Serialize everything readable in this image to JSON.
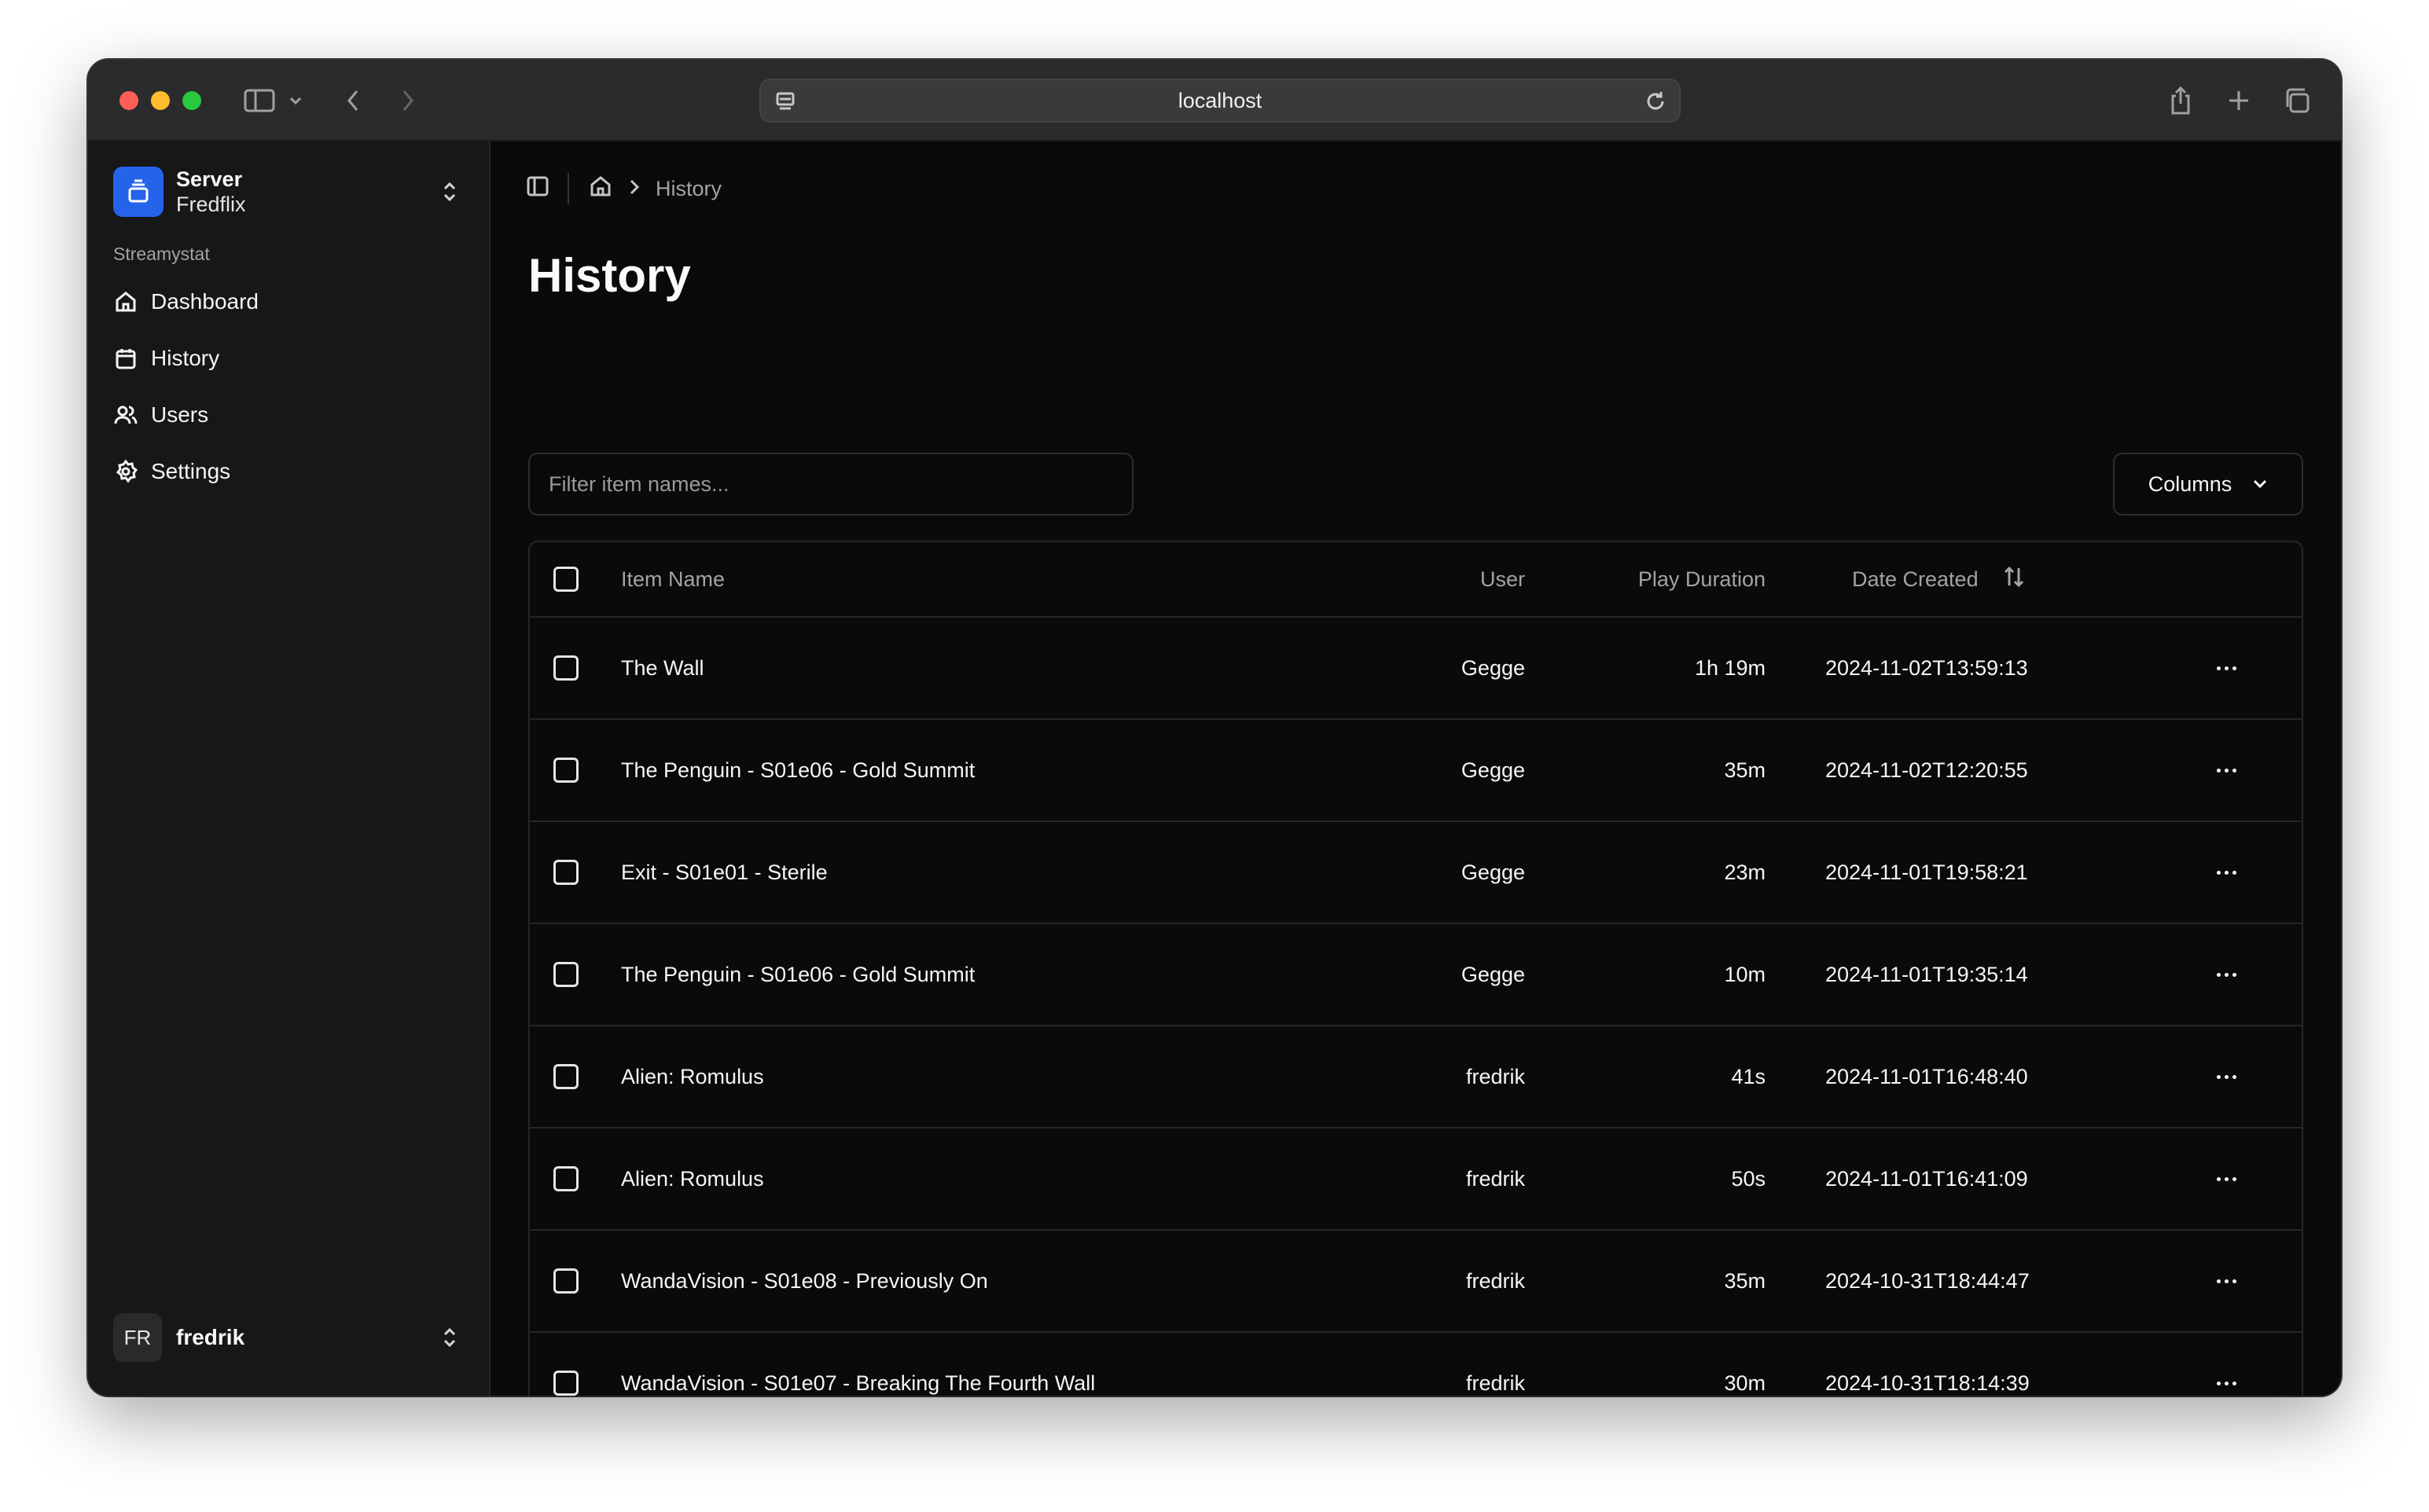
{
  "browser": {
    "url": "localhost"
  },
  "sidebar": {
    "server_title": "Server",
    "server_name": "Fredflix",
    "group_label": "Streamystat",
    "items": [
      {
        "label": "Dashboard",
        "icon": "home-icon"
      },
      {
        "label": "History",
        "icon": "calendar-icon"
      },
      {
        "label": "Users",
        "icon": "users-icon"
      },
      {
        "label": "Settings",
        "icon": "gear-icon"
      }
    ],
    "user": {
      "initials": "FR",
      "name": "fredrik"
    }
  },
  "breadcrumb": {
    "current": "History"
  },
  "page": {
    "title": "History",
    "filter_placeholder": "Filter item names...",
    "columns_label": "Columns"
  },
  "table": {
    "headers": {
      "item_name": "Item Name",
      "user": "User",
      "play_duration": "Play Duration",
      "date_created": "Date Created"
    },
    "rows": [
      {
        "name": "The Wall",
        "user": "Gegge",
        "duration": "1h 19m",
        "date": "2024-11-02T13:59:13"
      },
      {
        "name": "The Penguin - S01e06 - Gold Summit",
        "user": "Gegge",
        "duration": "35m",
        "date": "2024-11-02T12:20:55"
      },
      {
        "name": "Exit - S01e01 - Sterile",
        "user": "Gegge",
        "duration": "23m",
        "date": "2024-11-01T19:58:21"
      },
      {
        "name": "The Penguin - S01e06 - Gold Summit",
        "user": "Gegge",
        "duration": "10m",
        "date": "2024-11-01T19:35:14"
      },
      {
        "name": "Alien: Romulus",
        "user": "fredrik",
        "duration": "41s",
        "date": "2024-11-01T16:48:40"
      },
      {
        "name": "Alien: Romulus",
        "user": "fredrik",
        "duration": "50s",
        "date": "2024-11-01T16:41:09"
      },
      {
        "name": "WandaVision - S01e08 - Previously On",
        "user": "fredrik",
        "duration": "35m",
        "date": "2024-10-31T18:44:47"
      },
      {
        "name": "WandaVision - S01e07 - Breaking The Fourth Wall",
        "user": "fredrik",
        "duration": "30m",
        "date": "2024-10-31T18:14:39"
      }
    ]
  },
  "colors": {
    "accent": "#2563eb",
    "background": "#0a0a0a",
    "sidebar": "#171717"
  }
}
